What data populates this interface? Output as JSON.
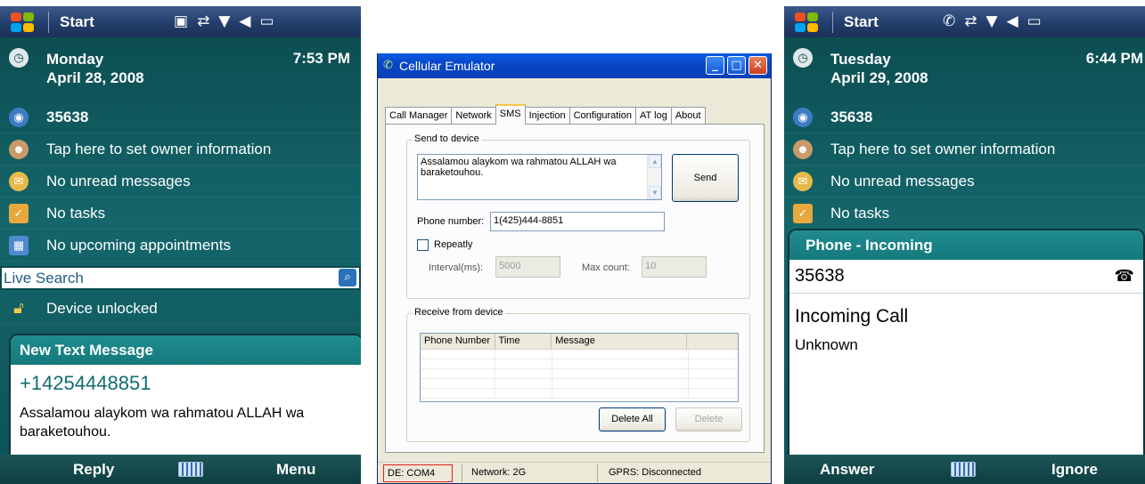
{
  "left_phone": {
    "start_label": "Start",
    "status_icons": [
      "sim-icon",
      "sync-icon",
      "signal-icon",
      "speaker-icon",
      "battery-icon"
    ],
    "date_line1": "Monday",
    "date_line2": "April 28, 2008",
    "time": "7:53 PM",
    "today_items": [
      {
        "icon": "network-icon",
        "label": "35638"
      },
      {
        "icon": "owner-icon",
        "label": "Tap here to set owner information"
      },
      {
        "icon": "messages-icon",
        "label": "No unread messages"
      },
      {
        "icon": "tasks-icon",
        "label": "No tasks"
      },
      {
        "icon": "calendar-icon",
        "label": "No upcoming appointments"
      }
    ],
    "search_label": "Live Search",
    "device_status": "Device unlocked",
    "notification": {
      "title": "New Text Message",
      "sender": "+14254448851",
      "body": "Assalamou alaykom wa rahmatou ALLAH wa baraketouhou."
    },
    "softkeys": {
      "left": "Reply",
      "right": "Menu"
    }
  },
  "emulator": {
    "title": "Cellular Emulator",
    "tabs": [
      "Call Manager",
      "Network",
      "SMS",
      "Injection",
      "Configuration",
      "AT log",
      "About"
    ],
    "active_tab": "SMS",
    "send_group": {
      "label": "Send to device",
      "message": "Assalamou alaykom wa rahmatou ALLAH wa baraketouhou.",
      "send_button": "Send",
      "phone_label": "Phone number:",
      "phone_value": "1(425)444-8851",
      "repeatly_label": "Repeatly",
      "interval_label": "Interval(ms):",
      "interval_value": "5000",
      "max_label": "Max count:",
      "max_value": "10"
    },
    "receive_group": {
      "label": "Receive from device",
      "columns": [
        "Phone Number",
        "Time",
        "Message",
        ""
      ],
      "delete_all_button": "Delete All",
      "delete_button": "Delete"
    },
    "status": {
      "port": "DE: COM4",
      "network": "Network: 2G",
      "gprs": "GPRS: Disconnected"
    }
  },
  "right_phone": {
    "start_label": "Start",
    "status_icons": [
      "call-icon",
      "sync-icon",
      "signal-icon",
      "speaker-icon",
      "battery-icon"
    ],
    "date_line1": "Tuesday",
    "date_line2": "April 29, 2008",
    "time": "6:44 PM",
    "today_items": [
      {
        "icon": "network-icon",
        "label": "35638"
      },
      {
        "icon": "owner-icon",
        "label": "Tap here to set owner information"
      },
      {
        "icon": "messages-icon",
        "label": "No unread messages"
      },
      {
        "icon": "tasks-icon",
        "label": "No tasks"
      }
    ],
    "incoming": {
      "title": "Phone - Incoming",
      "number": "35638",
      "heading": "Incoming Call",
      "caller": "Unknown"
    },
    "softkeys": {
      "left": "Answer",
      "right": "Ignore"
    }
  }
}
